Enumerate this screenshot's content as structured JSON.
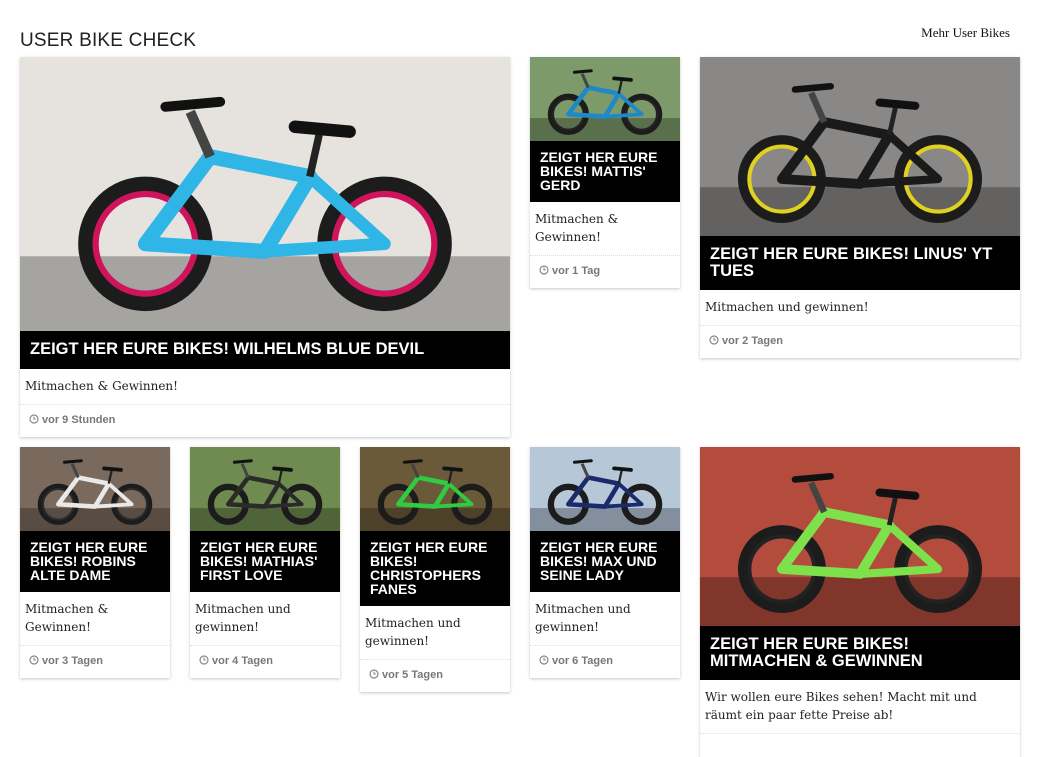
{
  "header": {
    "title": "USER BIKE CHECK",
    "more_link": "Mehr User Bikes"
  },
  "cards": [
    {
      "title": "ZEIGT HER EURE BIKES! WILHELMS BLUE DEVIL",
      "desc": "Mitmachen & Gewinnen!",
      "time": "vor 9 Stunden",
      "bike_color": "#2fb6e6",
      "rim_color": "#d0145c",
      "bg": "#e6e3de"
    },
    {
      "title": "ZEIGT HER EURE BIKES! MATTIS' GERD",
      "desc": "Mitmachen & Gewinnen!",
      "time": "vor 1 Tag",
      "bike_color": "#1e88c8",
      "rim_color": "#222222",
      "bg": "#7d9a6a"
    },
    {
      "title": "ZEIGT HER EURE BIKES! LINUS' YT TUES",
      "desc": "Mitmachen und gewinnen!",
      "time": "vor 2 Tagen",
      "bike_color": "#1a1a1a",
      "rim_color": "#e0d020",
      "bg": "#8a8886"
    },
    {
      "title": "ZEIGT HER EURE BIKES! ROBINS ALTE DAME",
      "desc": "Mitmachen & Gewinnen!",
      "time": "vor 3 Tagen",
      "bike_color": "#e9e9e9",
      "rim_color": "#2a2a2a",
      "bg": "#7a6a5e"
    },
    {
      "title": "ZEIGT HER EURE BIKES! MATHIAS' FIRST LOVE",
      "desc": "Mitmachen und gewinnen!",
      "time": "vor 4 Tagen",
      "bike_color": "#2a2a2a",
      "rim_color": "#1a1a1a",
      "bg": "#6f8b4f"
    },
    {
      "title": "ZEIGT HER EURE BIKES! CHRISTOPHERS FANES",
      "desc": "Mitmachen und gewinnen!",
      "time": "vor 5 Tagen",
      "bike_color": "#2ecc40",
      "rim_color": "#1a1a1a",
      "bg": "#6b5a3a"
    },
    {
      "title": "ZEIGT HER EURE BIKES! MAX UND SEINE LADY",
      "desc": "Mitmachen und gewinnen!",
      "time": "vor 6 Tagen",
      "bike_color": "#1b2a6a",
      "rim_color": "#1a1a1a",
      "bg": "#b6c7d8"
    },
    {
      "title": "ZEIGT HER EURE BIKES! MITMACHEN & GEWINNEN",
      "desc": "Wir wollen eure Bikes sehen! Macht mit und räumt ein paar fette Preise ab!",
      "time": "",
      "bike_color": "#7ee04a",
      "rim_color": "#222222",
      "bg": "#b34c3c"
    }
  ]
}
